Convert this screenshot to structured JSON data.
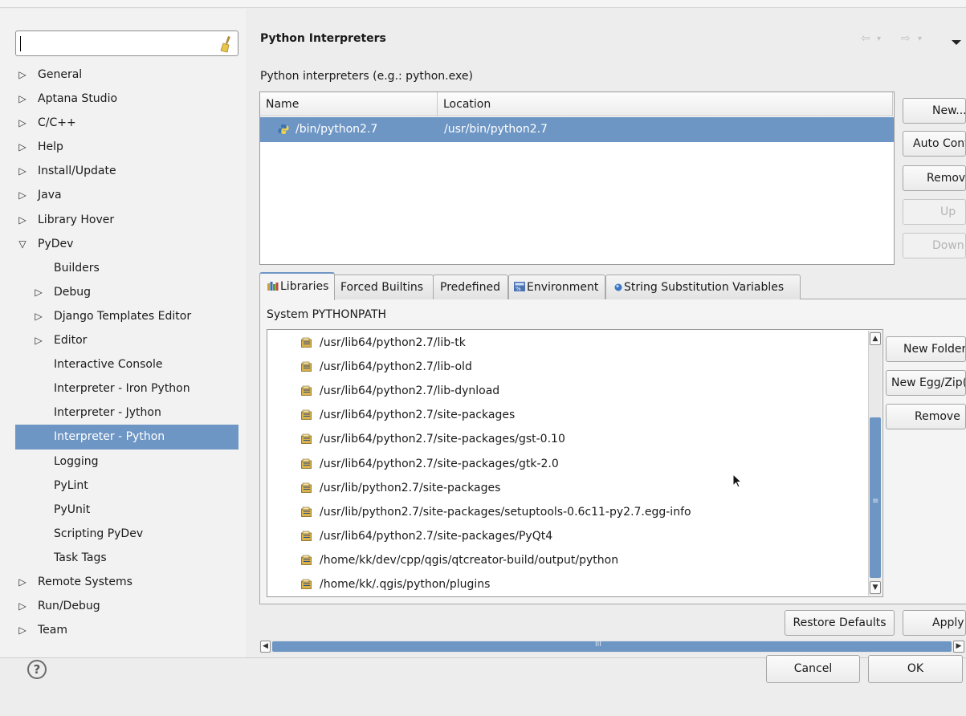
{
  "filter": {
    "value": ""
  },
  "tree": {
    "items": [
      {
        "label": "General",
        "level": 0,
        "expander": "collapsed"
      },
      {
        "label": "Aptana Studio",
        "level": 0,
        "expander": "collapsed"
      },
      {
        "label": "C/C++",
        "level": 0,
        "expander": "collapsed"
      },
      {
        "label": "Help",
        "level": 0,
        "expander": "collapsed"
      },
      {
        "label": "Install/Update",
        "level": 0,
        "expander": "collapsed"
      },
      {
        "label": "Java",
        "level": 0,
        "expander": "collapsed"
      },
      {
        "label": "Library Hover",
        "level": 0,
        "expander": "collapsed"
      },
      {
        "label": "PyDev",
        "level": 0,
        "expander": "expanded"
      },
      {
        "label": "Builders",
        "level": 1,
        "expander": "none"
      },
      {
        "label": "Debug",
        "level": 1,
        "expander": "collapsed"
      },
      {
        "label": "Django Templates Editor",
        "level": 1,
        "expander": "collapsed"
      },
      {
        "label": "Editor",
        "level": 1,
        "expander": "collapsed"
      },
      {
        "label": "Interactive Console",
        "level": 1,
        "expander": "none"
      },
      {
        "label": "Interpreter - Iron Python",
        "level": 1,
        "expander": "none"
      },
      {
        "label": "Interpreter - Jython",
        "level": 1,
        "expander": "none"
      },
      {
        "label": "Interpreter - Python",
        "level": 1,
        "expander": "none",
        "selected": true
      },
      {
        "label": "Logging",
        "level": 1,
        "expander": "none"
      },
      {
        "label": "PyLint",
        "level": 1,
        "expander": "none"
      },
      {
        "label": "PyUnit",
        "level": 1,
        "expander": "none"
      },
      {
        "label": "Scripting PyDev",
        "level": 1,
        "expander": "none"
      },
      {
        "label": "Task Tags",
        "level": 1,
        "expander": "none"
      },
      {
        "label": "Remote Systems",
        "level": 0,
        "expander": "collapsed"
      },
      {
        "label": "Run/Debug",
        "level": 0,
        "expander": "collapsed"
      },
      {
        "label": "Team",
        "level": 0,
        "expander": "collapsed"
      }
    ]
  },
  "page": {
    "title": "Python Interpreters",
    "nav_back": "⇦",
    "nav_forward": "⇨",
    "nav_dropdown": "▾"
  },
  "interpreters": {
    "label": "Python interpreters (e.g.: python.exe)",
    "columns": [
      "Name",
      "Location"
    ],
    "rows": [
      {
        "name": "/bin/python2.7",
        "location": "/usr/bin/python2.7",
        "selected": true
      }
    ],
    "buttons": {
      "new": "New...",
      "auto_config": "Auto Config",
      "remove": "Remove",
      "up": "Up",
      "down": "Down"
    }
  },
  "tabs": [
    {
      "label": "Libraries",
      "icon": "libraries-icon",
      "active": true
    },
    {
      "label": "Forced Builtins",
      "icon": ""
    },
    {
      "label": "Predefined",
      "icon": ""
    },
    {
      "label": "Environment",
      "icon": "environment-icon"
    },
    {
      "label": "String Substitution Variables",
      "icon": "variable-icon"
    }
  ],
  "libraries": {
    "label": "System PYTHONPATH",
    "paths": [
      "/usr/lib64/python2.7/lib-tk",
      "/usr/lib64/python2.7/lib-old",
      "/usr/lib64/python2.7/lib-dynload",
      "/usr/lib64/python2.7/site-packages",
      "/usr/lib64/python2.7/site-packages/gst-0.10",
      "/usr/lib64/python2.7/site-packages/gtk-2.0",
      "/usr/lib/python2.7/site-packages",
      "/usr/lib/python2.7/site-packages/setuptools-0.6c11-py2.7.egg-info",
      "/usr/lib64/python2.7/site-packages/PyQt4",
      "/home/kk/dev/cpp/qgis/qtcreator-build/output/python",
      "/home/kk/.qgis/python/plugins"
    ],
    "buttons": {
      "new_folder": "New Folder",
      "new_egg": "New Egg/Zip(s)",
      "remove": "Remove"
    }
  },
  "footer": {
    "restore_defaults": "Restore Defaults",
    "apply": "Apply",
    "cancel": "Cancel",
    "ok": "OK",
    "help": "?"
  },
  "colors": {
    "selection": "#6e96c4",
    "panel": "#f2f2f2"
  }
}
